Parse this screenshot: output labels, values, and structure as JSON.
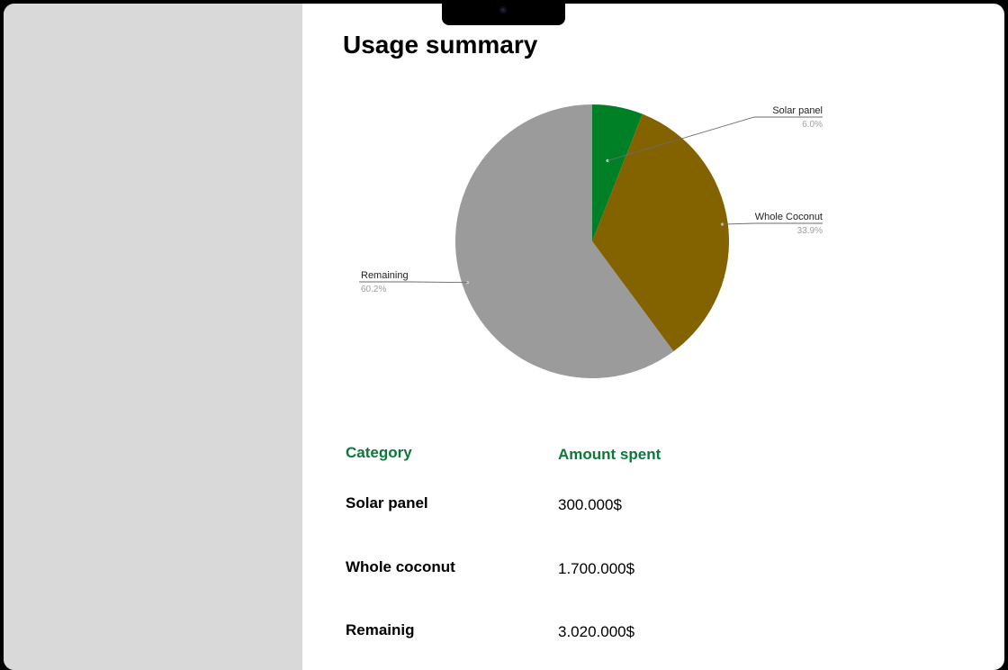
{
  "page": {
    "title": "Usage summary"
  },
  "chart_data": {
    "type": "pie",
    "slices": [
      {
        "label": "Solar panel",
        "value": 6.0,
        "pct_label": "6.0%",
        "color": "#008026"
      },
      {
        "label": "Whole Coconut",
        "value": 33.9,
        "pct_label": "33.9%",
        "color": "#836300"
      },
      {
        "label": "Remaining",
        "value": 60.2,
        "pct_label": "60.2%",
        "color": "#9b9b9b"
      }
    ]
  },
  "table": {
    "headers": {
      "category": "Category",
      "amount": "Amount spent"
    },
    "rows": [
      {
        "category": "Solar panel",
        "amount": "300.000$"
      },
      {
        "category": "Whole coconut",
        "amount": "1.700.000$"
      },
      {
        "category": "Remainig",
        "amount": "3.020.000$"
      }
    ]
  },
  "colors": {
    "accent": "#0a7a3a",
    "sidebar": "#d9d9d9"
  }
}
